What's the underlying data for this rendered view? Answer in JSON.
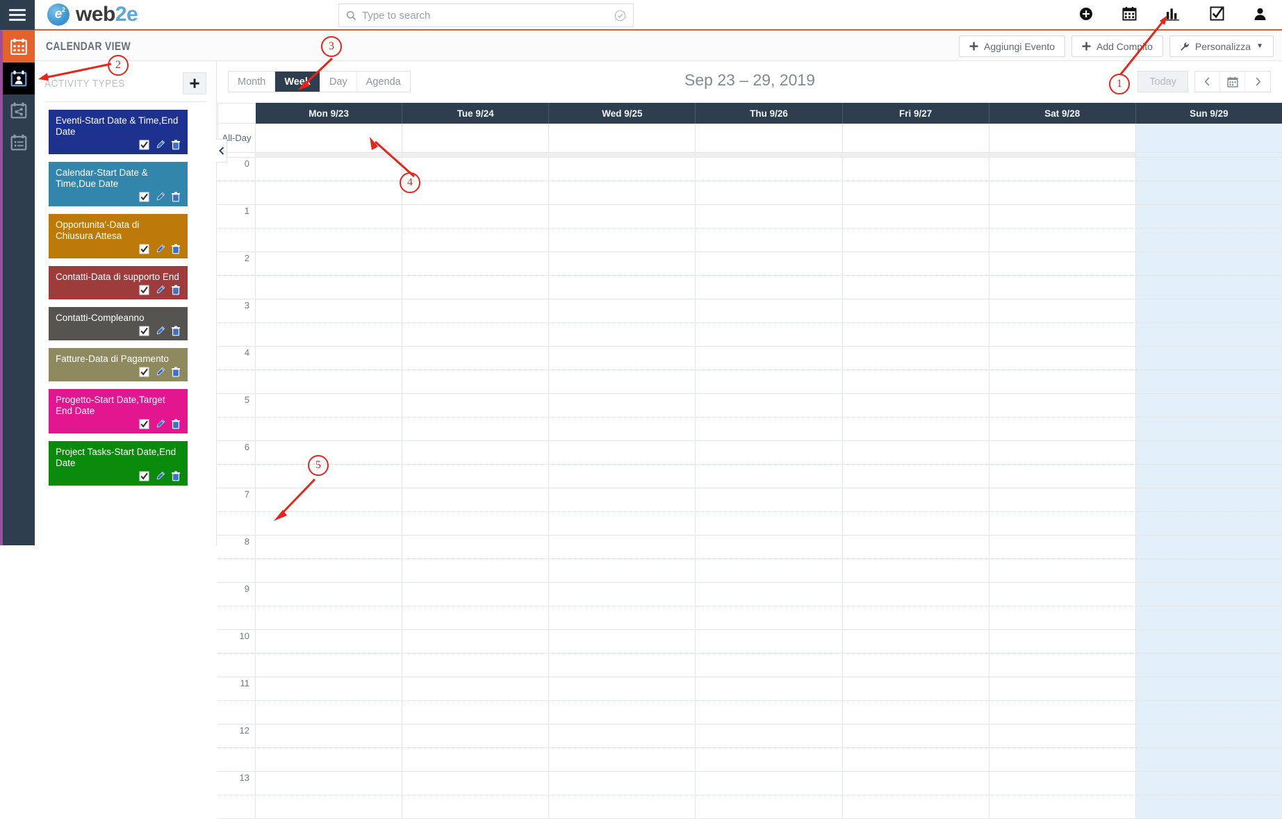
{
  "topbar": {
    "menu_icon": "hamburger-icon",
    "brand": {
      "e": "e",
      "sup": "2",
      "word_dark": "web",
      "word_light": "2e",
      "full": "web2e"
    },
    "search": {
      "placeholder": "Type to search",
      "value": "",
      "icon": "search-icon",
      "clear_icon": "check-circle-icon"
    },
    "icons": [
      {
        "name": "add-circle-icon",
        "glyph": "add"
      },
      {
        "name": "calendar-icon",
        "glyph": "calendar"
      },
      {
        "name": "chart-icon",
        "glyph": "chart"
      },
      {
        "name": "checkbox-icon",
        "glyph": "checkbox"
      },
      {
        "name": "user-icon",
        "glyph": "user"
      }
    ]
  },
  "rail": {
    "items": [
      {
        "name": "rail-calendar",
        "state": "active-orange"
      },
      {
        "name": "rail-calendar-contact",
        "state": "active-black"
      },
      {
        "name": "rail-calendar-share",
        "state": "idle"
      },
      {
        "name": "rail-calendar-list",
        "state": "idle"
      }
    ]
  },
  "page_header": {
    "title": "CALENDAR VIEW",
    "buttons": [
      {
        "label": "Aggiungi Evento",
        "icon": "plus-icon",
        "name": "add-event-button"
      },
      {
        "label": "Add Compito",
        "icon": "plus-icon",
        "name": "add-task-button"
      },
      {
        "label": "Personalizza",
        "icon": "wrench-icon",
        "name": "customize-button",
        "caret": true
      }
    ]
  },
  "sidebar": {
    "title": "ACTIVITY TYPES",
    "add_label": "+",
    "activity_types": [
      {
        "label": "Eventi-Start Date & Time,End Date",
        "color": "#1d328f"
      },
      {
        "label": "Calendar-Start Date & Time,Due Date",
        "color": "#3286ab"
      },
      {
        "label": "Opportunita'-Data di Chiusura Attesa",
        "color": "#bd7a08"
      },
      {
        "label": "Contatti-Data di supporto End",
        "color": "#9e3b3b"
      },
      {
        "label": "Contatti-Compleanno",
        "color": "#565450"
      },
      {
        "label": "Fatture-Data di Pagamento",
        "color": "#8e8a5d"
      },
      {
        "label": "Progetto-Start Date,Target End Date",
        "color": "#e2178f"
      },
      {
        "label": "Project Tasks-Start Date,End Date",
        "color": "#0a8a0a"
      }
    ],
    "row_icons": [
      "checkbox-icon",
      "pencil-icon",
      "trash-icon"
    ]
  },
  "calendar": {
    "collapse_icon": "chevron-left-icon",
    "view_tabs": [
      {
        "label": "Month",
        "active": false
      },
      {
        "label": "Week",
        "active": true
      },
      {
        "label": "Day",
        "active": false
      },
      {
        "label": "Agenda",
        "active": false
      }
    ],
    "title": "Sep 23 – 29, 2019",
    "today_label": "Today",
    "nav": [
      {
        "name": "prev-button",
        "glyph": "‹"
      },
      {
        "name": "datepicker-button",
        "glyph": "calendar"
      },
      {
        "name": "next-button",
        "glyph": "›"
      }
    ],
    "gutter_header": "",
    "allday_label": "All-Day",
    "days": [
      {
        "label": "Mon 9/23",
        "weekend": false
      },
      {
        "label": "Tue 9/24",
        "weekend": false
      },
      {
        "label": "Wed 9/25",
        "weekend": false
      },
      {
        "label": "Thu 9/26",
        "weekend": false
      },
      {
        "label": "Fri 9/27",
        "weekend": false
      },
      {
        "label": "Sat 9/28",
        "weekend": false
      },
      {
        "label": "Sun 9/29",
        "weekend": true
      }
    ],
    "hours": [
      "0",
      "1",
      "2",
      "3",
      "4",
      "5",
      "6",
      "7",
      "8",
      "9",
      "10",
      "11",
      "12",
      "13"
    ]
  },
  "annotations": [
    {
      "number": "1",
      "name": "annotation-1"
    },
    {
      "number": "2",
      "name": "annotation-2"
    },
    {
      "number": "3",
      "name": "annotation-3"
    },
    {
      "number": "4",
      "name": "annotation-4"
    },
    {
      "number": "5",
      "name": "annotation-5"
    }
  ],
  "colors": {
    "accent_orange": "#e8532a",
    "navy": "#2e3e4e",
    "annotation_red": "#e8231a",
    "weekend_blue": "#e3eff9"
  }
}
